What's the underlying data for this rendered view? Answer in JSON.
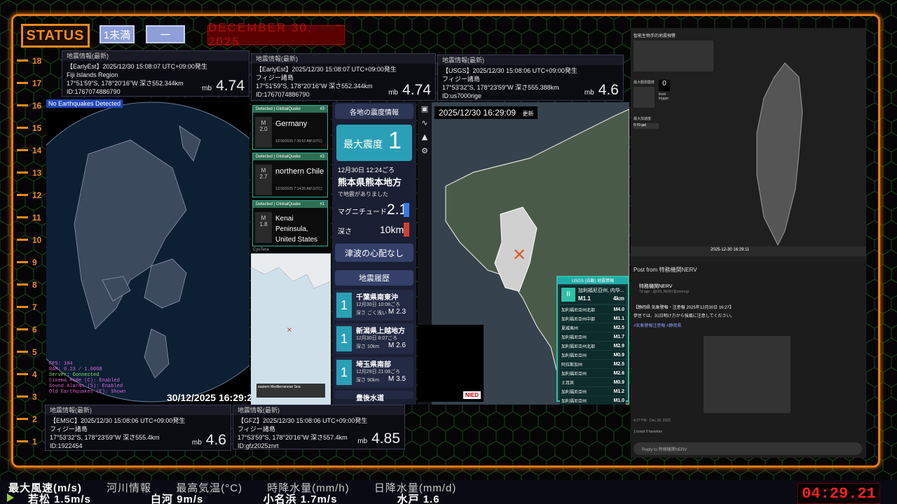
{
  "status": {
    "label": "STATUS",
    "chip1": "1未満",
    "chip2": "一",
    "date": "DECEMBER 30, 2025"
  },
  "ruler": {
    "ticks": [
      "18",
      "17",
      "16",
      "15",
      "14",
      "13",
      "12",
      "11",
      "10",
      "9",
      "8",
      "7",
      "6",
      "5",
      "4",
      "3",
      "2",
      "1"
    ]
  },
  "cards": [
    {
      "title": "地震情報(最新)",
      "line1": "【EarlyEst】2025/12/30  15:08:07  UTC+09:00発生",
      "line2": "Fiji Islands Region",
      "line3": "17°51'59\"S, 178°20'16\"W  深さ552.344km",
      "line4": "ID:1767074886790",
      "mb": "mb",
      "mag": "4.74"
    },
    {
      "title": "地震情報(最新)",
      "line1": "【EarlyEst】2025/12/30  15:08:07  UTC+09:00発生",
      "line2": "フィジー諸島",
      "line3": "17°51'59\"S, 178°20'16\"W  深さ552.344km",
      "line4": "ID:1767074886790",
      "mb": "mb",
      "mag": "4.74"
    },
    {
      "title": "地震情報(最新)",
      "line1": "【USGS】2025/12/30  15:08:06  UTC+09:00発生",
      "line2": "フィジー諸島",
      "line3": "17°53'32\"S, 178°23'59\"W  深さ555.388km",
      "line4": "ID:us7000rige",
      "mb": "mb",
      "mag": "4.6"
    },
    {
      "title": "地震情報(最新)",
      "line1": "【EMSC】2025/12/30  15:08:06  UTC+09:00発生",
      "line2": "フィジー諸島",
      "line3": "17°53'32\"S, 178°23'59\"W  深さ555.4km",
      "line4": "ID:1922454",
      "mb": "mb",
      "mag": "4.6"
    },
    {
      "title": "地震情報(最新)",
      "line1": "【GFZ】2025/12/30  15:08:06  UTC+09:00発生",
      "line2": "フィジー諸島",
      "line3": "17°53'59\"S, 178°20'16\"W  深さ557.4km",
      "line4": "ID:gfz2025znrt",
      "mb": "mb",
      "mag": "4.85"
    }
  ],
  "globe": {
    "no_eq": "No Earthquakes Detected",
    "timestamp": "30/12/2025 16:29:27",
    "overlay": [
      "FPS: 104",
      "RAM: 0.23 / 1.00GB",
      "Server: Connected",
      "Cinema Mode (C): Enabled",
      "Sound Alarms (S): Enabled",
      "Old Earthquakes (E): Shown"
    ]
  },
  "gq": {
    "cards": [
      {
        "src": "Detected | GlobalQuake",
        "num": "#3",
        "mag": "2.0",
        "region": "Germany",
        "sub": "12/30/2025 7:35:52 AM (UTC)"
      },
      {
        "src": "Detected | GlobalQuake",
        "num": "#3",
        "mag": "2.7",
        "region": "northern Chile",
        "sub": "12/30/2025 7:14:35 AM (UTC)"
      },
      {
        "src": "Detected | GlobalQuake",
        "num": "#1",
        "mag": "1.8",
        "region": "Kenai Peninsula, United States",
        "sub": "12/30/2025 7:13:08 AM (UTC)"
      }
    ],
    "footer": "CyoTera",
    "map_label": "eastern Mediterranean Sea"
  },
  "jp": {
    "header": "各地の震度情報",
    "max_label": "最大震度",
    "max_value": "1",
    "time": "12月30日 12:24ごろ",
    "place": "熊本県熊本地方",
    "note": "で地震がありました",
    "mag_label": "マグニチュード",
    "mag": "2.1",
    "depth_label": "深さ",
    "depth": "10km",
    "tsunami": "津波の心配なし",
    "history_label": "地震履歴",
    "history": [
      {
        "int": "1",
        "place": "千葉県南東沖",
        "time": "12月30日 10:08ごろ",
        "depth": "深さ ごく浅い",
        "mag": "M 2.3"
      },
      {
        "int": "1",
        "place": "新潟県上越地方",
        "time": "12月30日 8:07ごろ",
        "depth": "深さ 10km",
        "mag": "M 2.6"
      },
      {
        "int": "1",
        "place": "埼玉県南部",
        "time": "12月29日 21:08ごろ",
        "depth": "深さ 90km",
        "mag": "M 3.5"
      },
      {
        "int": "",
        "place": "豊後水道",
        "time": "",
        "depth": "",
        "mag": ""
      }
    ]
  },
  "kmap": {
    "timestamp": "2025/12/30  16:29:09",
    "update": "更新",
    "usgs_title": "USGS (自動) 地震情報",
    "usgs_place": "加利福尼亞州, 内华...",
    "usgs_mag": "M1.1",
    "usgs_depth": "4km",
    "usgs_rows": [
      {
        "name": "加利福尼亞州北部",
        "m": "M4.0"
      },
      {
        "name": "加利福尼亞州中部",
        "m": "M1.1"
      },
      {
        "name": "夏威夷州",
        "m": "M2.5"
      },
      {
        "name": "加利福尼亞州",
        "m": "M1.7"
      },
      {
        "name": "加利福尼亞州北部",
        "m": "M2.9"
      },
      {
        "name": "加利福尼亞州",
        "m": "M0.9"
      },
      {
        "name": "阿拉斯加州",
        "m": "M2.5"
      },
      {
        "name": "加利福尼亞州",
        "m": "M2.6"
      },
      {
        "name": "土耳其",
        "m": "M0.9"
      },
      {
        "name": "加利福尼亞州",
        "m": "M1.2"
      },
      {
        "name": "加利福尼亞州",
        "m": "M1.0"
      }
    ],
    "nied": "NIED"
  },
  "tw": {
    "title": "智能生物手的地震預警",
    "max_label": "最大觀測震度",
    "max_value": "0",
    "level": "level",
    "trigger": "trigger",
    "stat_label": "最大加速度",
    "stat_value": "0.70 gal",
    "timestamp": "2025-12-30 16:29:11",
    "post_header": "Post from 特務機関NERV",
    "account": "特務機関NERV",
    "handle": "7d ago · @UN_NERV@unerv.jp",
    "post_line1": "【静岡県 気象警報・注意報 2025年12月30日 16:27】",
    "post_line2": "伊豆では、31日明け方から強風に注意してください。",
    "post_tags": "#気象警報注意報 #静岡県",
    "post_time": "4:27 PM · Dec 30, 2025",
    "stats": "1 boost   0 favorites",
    "reply": "Reply to 特務機関NERV"
  },
  "ticker": {
    "row1": [
      "最大風速(m/s)",
      "河川情報",
      "最高気温(°C)",
      "時降水量(mm/h)",
      "日降水量(mm/d)"
    ],
    "row2": [
      "若松 1.5m/s",
      "白河 9m/s",
      "小名浜 1.7m/s",
      "水戸 1.6"
    ],
    "clock": "04:29.21"
  },
  "colors": {
    "accent": "#e87a1a",
    "teal": "#2aa0b6",
    "clock": "#ff2020"
  }
}
